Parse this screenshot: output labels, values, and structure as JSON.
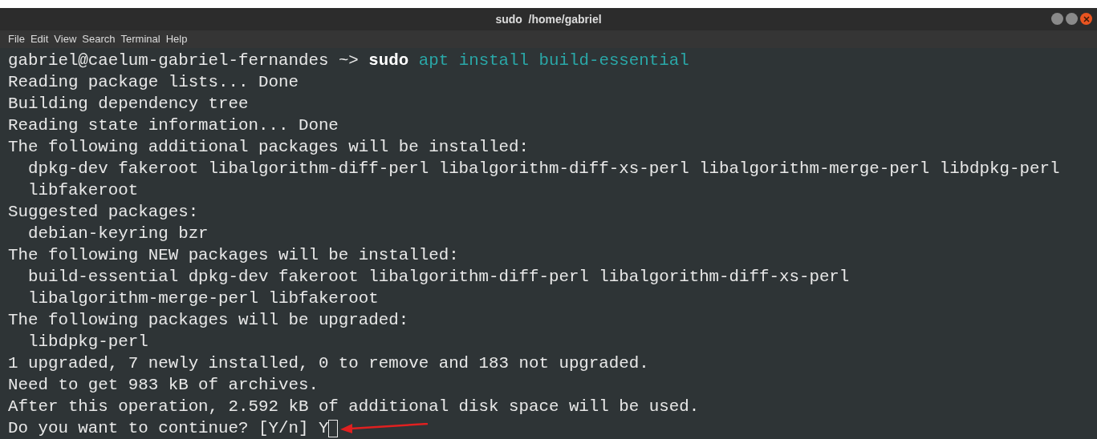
{
  "window": {
    "title": "sudo  /home/gabriel"
  },
  "menu": [
    "File",
    "Edit",
    "View",
    "Search",
    "Terminal",
    "Help"
  ],
  "prompt": [
    {
      "kind": "user",
      "text": "gabriel@caelum-gabriel-fernandes"
    },
    {
      "kind": "path",
      "text": "~>"
    },
    {
      "kind": "command",
      "text": "sudo"
    },
    {
      "kind": "args",
      "text": "apt install build-essential"
    }
  ],
  "output": [
    "Reading package lists... Done",
    "Building dependency tree",
    "Reading state information... Done",
    "The following additional packages will be installed:",
    "  dpkg-dev fakeroot libalgorithm-diff-perl libalgorithm-diff-xs-perl libalgorithm-merge-perl libdpkg-perl",
    "  libfakeroot",
    "Suggested packages:",
    "  debian-keyring bzr",
    "The following NEW packages will be installed:",
    "  build-essential dpkg-dev fakeroot libalgorithm-diff-perl libalgorithm-diff-xs-perl",
    "  libalgorithm-merge-perl libfakeroot",
    "The following packages will be upgraded:",
    "  libdpkg-perl",
    "1 upgraded, 7 newly installed, 0 to remove and 183 not upgraded.",
    "Need to get 983 kB of archives.",
    "After this operation, 2.592 kB of additional disk space will be used."
  ],
  "input_line": {
    "prompt": "Do you want to continue? [Y/n]",
    "typed": "Y"
  }
}
